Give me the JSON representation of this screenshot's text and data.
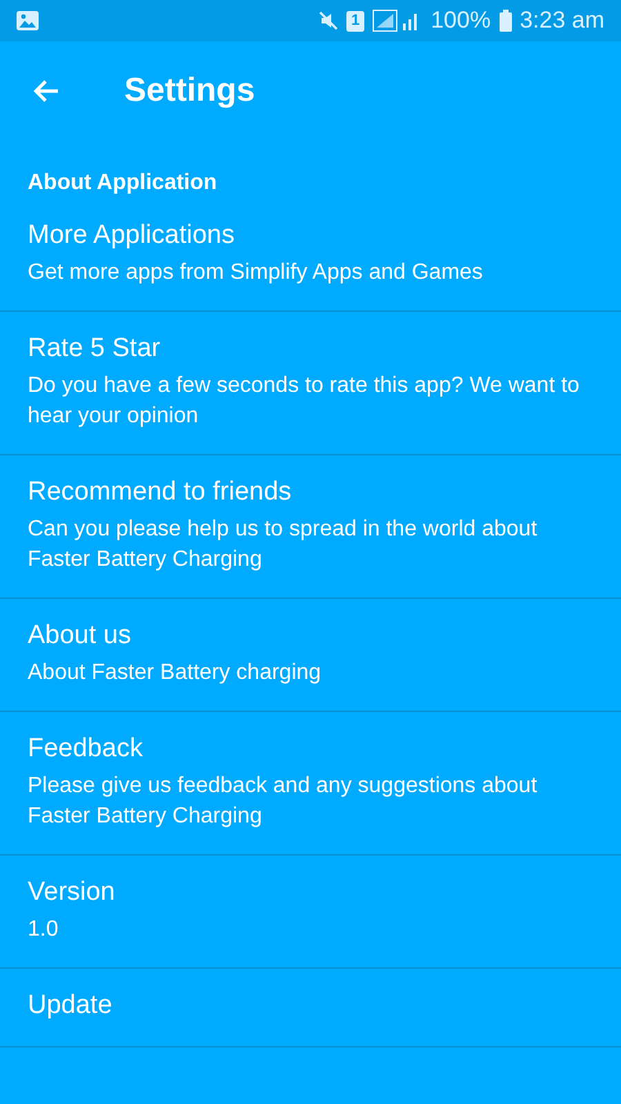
{
  "status_bar": {
    "sim_badge": "1",
    "battery": "100%",
    "time": "3:23 am"
  },
  "toolbar": {
    "title": "Settings"
  },
  "section": {
    "title": "About Application"
  },
  "items": [
    {
      "title": "More Applications",
      "subtitle": "Get more apps from Simplify Apps and Games"
    },
    {
      "title": "Rate 5 Star",
      "subtitle": "Do you have a few seconds to rate this app? We want to hear your opinion"
    },
    {
      "title": "Recommend to friends",
      "subtitle": "Can you please help us to spread in the world about Faster Battery Charging"
    },
    {
      "title": "About us",
      "subtitle": "About Faster Battery charging"
    },
    {
      "title": "Feedback",
      "subtitle": "Please give us feedback and any suggestions about Faster Battery Charging"
    },
    {
      "title": "Version",
      "subtitle": "1.0"
    },
    {
      "title": "Update"
    }
  ]
}
